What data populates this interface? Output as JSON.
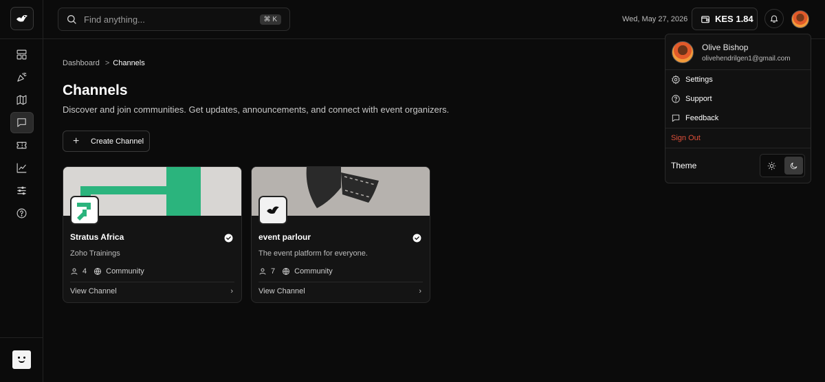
{
  "header": {
    "search_placeholder": "Find anything...",
    "search_shortcut": "⌘ K",
    "date": "Wed, May 27, 2026",
    "wallet_balance": "KES 1.84"
  },
  "sidebar": {
    "items": [
      {
        "icon": "dashboard-icon"
      },
      {
        "icon": "party-popper-icon"
      },
      {
        "icon": "map-icon"
      },
      {
        "icon": "channels-icon",
        "active": true
      },
      {
        "icon": "ticket-icon"
      },
      {
        "icon": "analytics-icon"
      },
      {
        "icon": "sliders-icon"
      },
      {
        "icon": "help-icon"
      }
    ]
  },
  "breadcrumb": {
    "parent": "Dashboard",
    "separator": ">",
    "current": "Channels"
  },
  "page": {
    "title": "Channels",
    "subtitle": "Discover and join communities. Get updates, announcements, and connect with event organizers.",
    "create_button": "Create Channel"
  },
  "channels": [
    {
      "name": "Stratus Africa",
      "description": "Zoho Trainings",
      "members": "4",
      "visibility": "Community",
      "action": "View Channel",
      "verified": true
    },
    {
      "name": "event parlour",
      "description": "The event platform for everyone.",
      "members": "7",
      "visibility": "Community",
      "action": "View Channel",
      "verified": true
    }
  ],
  "user_menu": {
    "name": "Olive Bishop",
    "email": "olivehendrilgen1@gmail.com",
    "items": [
      "Settings",
      "Support",
      "Feedback"
    ],
    "sign_out": "Sign Out",
    "theme_label": "Theme",
    "theme_selected": "dark"
  },
  "colors": {
    "background": "#0b0b0b",
    "sign_out": "#e0503a",
    "stratus_green": "#2bb47d"
  }
}
